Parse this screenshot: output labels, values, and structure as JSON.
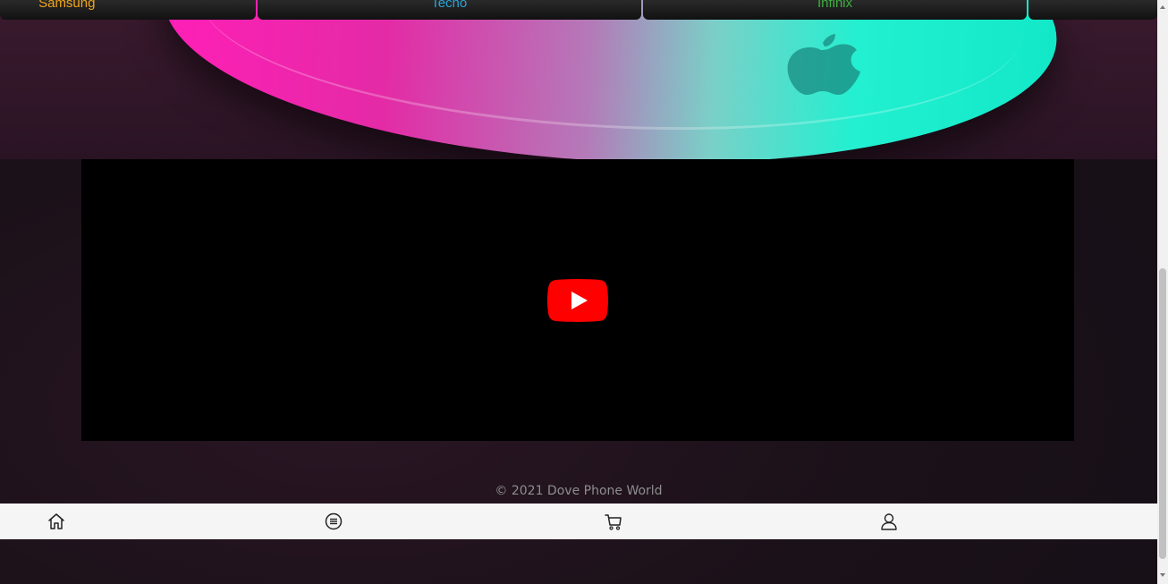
{
  "brands": [
    {
      "label": "Samsung",
      "color": "#f2a51a"
    },
    {
      "label": "Tecno",
      "color": "#2aa4d8"
    },
    {
      "label": "Infinix",
      "color": "#3fae3f"
    },
    {
      "label": "",
      "color": "#ffffff"
    }
  ],
  "hero": {
    "image_icon": "apple-mouse-image"
  },
  "video": {
    "play_icon": "youtube-play-icon",
    "play_color": "#ff0000"
  },
  "footer": {
    "copyright": "© 2021 Dove Phone World"
  },
  "bottom_nav": {
    "items": [
      {
        "icon": "home-icon"
      },
      {
        "icon": "menu-icon"
      },
      {
        "icon": "cart-icon"
      },
      {
        "icon": "user-icon"
      }
    ]
  }
}
